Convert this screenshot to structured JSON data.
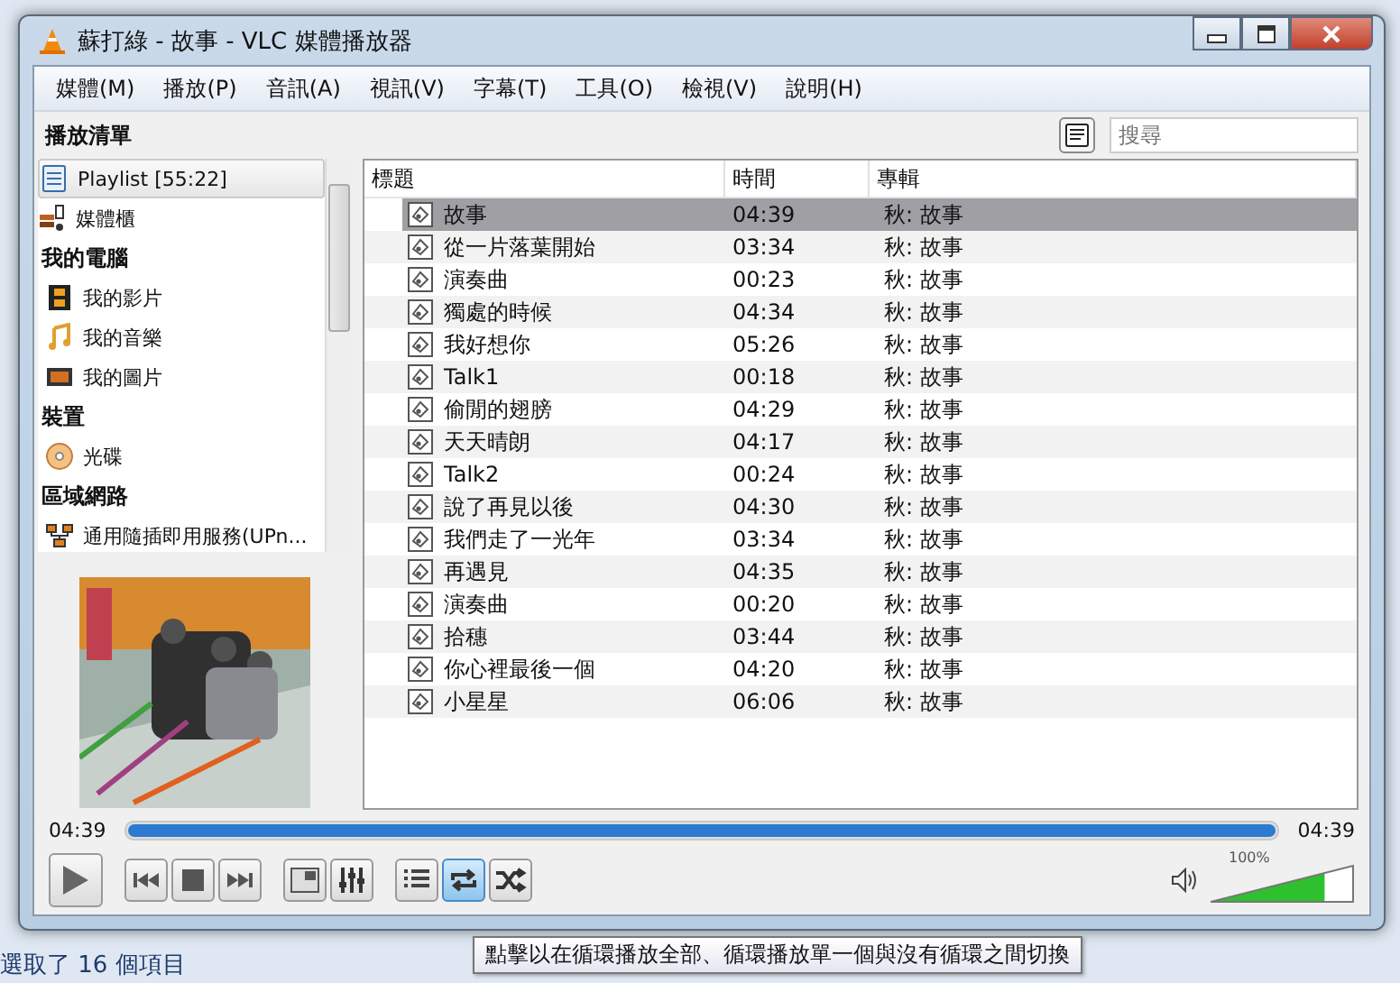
{
  "window": {
    "title": "蘇打綠 - 故事 - VLC 媒體播放器"
  },
  "menu": [
    "媒體(M)",
    "播放(P)",
    "音訊(A)",
    "視訊(V)",
    "字幕(T)",
    "工具(O)",
    "檢視(V)",
    "說明(H)"
  ],
  "playlist_header": {
    "title": "播放清單",
    "search": {
      "placeholder": "搜尋"
    }
  },
  "sidebar": {
    "items": [
      {
        "kind": "item",
        "label": "Playlist [55:22]",
        "selected": true
      },
      {
        "kind": "item",
        "label": "媒體櫃",
        "selected": false
      },
      {
        "kind": "heading",
        "label": "我的電腦"
      },
      {
        "kind": "item",
        "label": "我的影片",
        "selected": false
      },
      {
        "kind": "item",
        "label": "我的音樂",
        "selected": false
      },
      {
        "kind": "item",
        "label": "我的圖片",
        "selected": false
      },
      {
        "kind": "heading",
        "label": "裝置"
      },
      {
        "kind": "item",
        "label": "光碟",
        "selected": false
      },
      {
        "kind": "heading",
        "label": "區域網路"
      },
      {
        "kind": "item",
        "label": "通用隨插即用服務(UPn...",
        "selected": false
      }
    ]
  },
  "table": {
    "columns": [
      "標題",
      "時間",
      "專輯"
    ],
    "rows": [
      {
        "title": "故事",
        "time": "04:39",
        "album": "秋: 故事",
        "selected": true
      },
      {
        "title": "從一片落葉開始",
        "time": "03:34",
        "album": "秋: 故事",
        "selected": false
      },
      {
        "title": "演奏曲",
        "time": "00:23",
        "album": "秋: 故事",
        "selected": false
      },
      {
        "title": "獨處的時候",
        "time": "04:34",
        "album": "秋: 故事",
        "selected": false
      },
      {
        "title": "我好想你",
        "time": "05:26",
        "album": "秋: 故事",
        "selected": false
      },
      {
        "title": "Talk1",
        "time": "00:18",
        "album": "秋: 故事",
        "selected": false
      },
      {
        "title": "偷閒的翅膀",
        "time": "04:29",
        "album": "秋: 故事",
        "selected": false
      },
      {
        "title": "天天晴朗",
        "time": "04:17",
        "album": "秋: 故事",
        "selected": false
      },
      {
        "title": "Talk2",
        "time": "00:24",
        "album": "秋: 故事",
        "selected": false
      },
      {
        "title": "說了再見以後",
        "time": "04:30",
        "album": "秋: 故事",
        "selected": false
      },
      {
        "title": "我們走了一光年",
        "time": "03:34",
        "album": "秋: 故事",
        "selected": false
      },
      {
        "title": "再遇見",
        "time": "04:35",
        "album": "秋: 故事",
        "selected": false
      },
      {
        "title": "演奏曲",
        "time": "00:20",
        "album": "秋: 故事",
        "selected": false
      },
      {
        "title": "拾穗",
        "time": "03:44",
        "album": "秋: 故事",
        "selected": false
      },
      {
        "title": "你心裡最後一個",
        "time": "04:20",
        "album": "秋: 故事",
        "selected": false
      },
      {
        "title": "小星星",
        "time": "06:06",
        "album": "秋: 故事",
        "selected": false
      }
    ]
  },
  "seek": {
    "elapsed": "04:39",
    "total": "04:39",
    "level": 1
  },
  "controls": {
    "loop_selected": true,
    "volume": {
      "reading": "100%",
      "level": 0.8
    }
  },
  "tooltip": "點擊以在循環播放全部、循環播放單一個與沒有循環之間切換",
  "status_bar": "選取了 16 個項目"
}
